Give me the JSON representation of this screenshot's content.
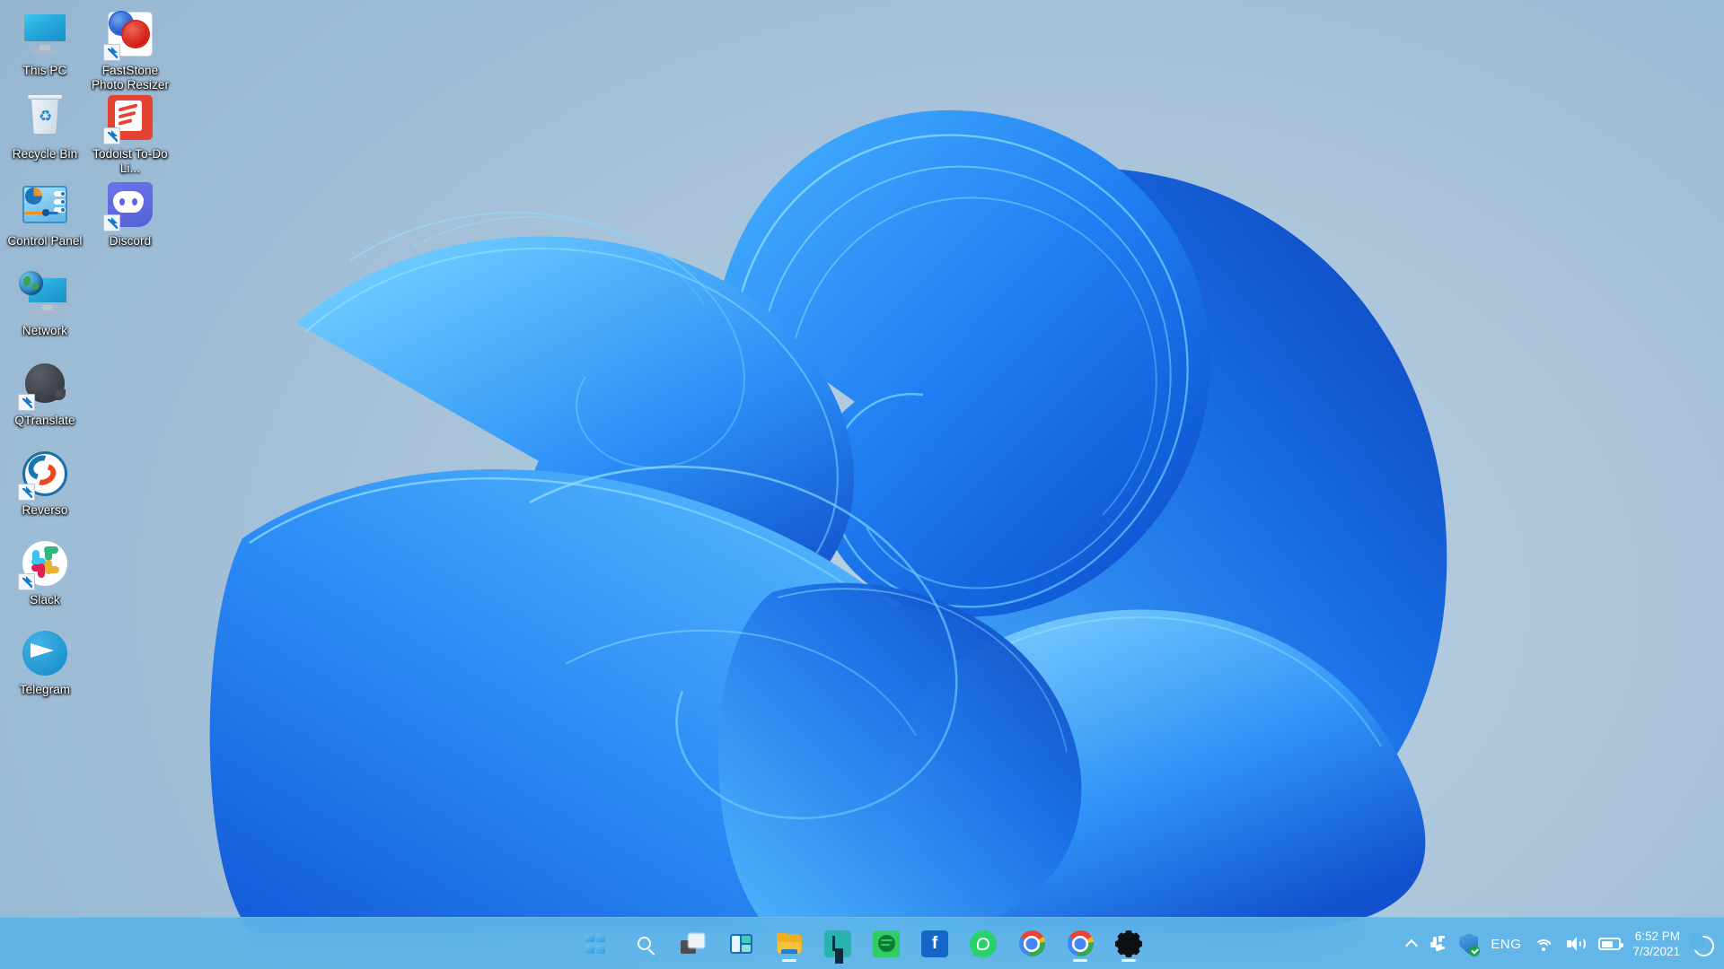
{
  "os": {
    "name": "Windows 11",
    "wallpaper": "bloom-abstract-blue"
  },
  "colors": {
    "desktop_bg": "#a9c4dc",
    "bloom_blue": "#1a7ef0",
    "bloom_light": "#43b0ff",
    "taskbar_bg": "#5ab4e9",
    "icon_label_text": "#ffffff"
  },
  "desktop": {
    "icons": [
      {
        "name": "this-pc",
        "label": "This PC",
        "shortcut": false,
        "col": 0,
        "row": 0
      },
      {
        "name": "faststone",
        "label": "FastStone Photo Resizer",
        "shortcut": true,
        "col": 1,
        "row": 0
      },
      {
        "name": "recycle-bin",
        "label": "Recycle Bin",
        "shortcut": false,
        "col": 0,
        "row": 1
      },
      {
        "name": "todoist",
        "label": "Todoist To-Do Li...",
        "shortcut": true,
        "col": 1,
        "row": 1
      },
      {
        "name": "control-panel",
        "label": "Control Panel",
        "shortcut": false,
        "col": 0,
        "row": 2
      },
      {
        "name": "discord",
        "label": "Discord",
        "shortcut": true,
        "col": 1,
        "row": 2
      },
      {
        "name": "network",
        "label": "Network",
        "shortcut": false,
        "col": 0,
        "row": 3
      },
      {
        "name": "qtranslate",
        "label": "QTranslate",
        "shortcut": true,
        "col": 0,
        "row": 4
      },
      {
        "name": "reverso",
        "label": "Reverso",
        "shortcut": true,
        "col": 0,
        "row": 5
      },
      {
        "name": "slack",
        "label": "Slack",
        "shortcut": true,
        "col": 0,
        "row": 6
      },
      {
        "name": "telegram",
        "label": "Telegram",
        "shortcut": false,
        "col": 0,
        "row": 7
      }
    ]
  },
  "taskbar": {
    "buttons": [
      {
        "name": "start",
        "label": "Start",
        "icon": "windows-logo-icon",
        "active": false
      },
      {
        "name": "search",
        "label": "Search",
        "icon": "search-icon",
        "active": false
      },
      {
        "name": "task-view",
        "label": "Task View",
        "icon": "task-view-icon",
        "active": false
      },
      {
        "name": "widgets",
        "label": "Widgets",
        "icon": "widgets-icon",
        "active": false
      },
      {
        "name": "file-explorer",
        "label": "File Explorer",
        "icon": "folder-icon",
        "active": true
      },
      {
        "name": "lightshot",
        "label": "L",
        "icon": "letter-l-icon",
        "active": false
      },
      {
        "name": "spotify",
        "label": "Spotify",
        "icon": "spotify-icon",
        "active": false
      },
      {
        "name": "facebook",
        "label": "Facebook",
        "icon": "facebook-icon",
        "active": false
      },
      {
        "name": "whatsapp",
        "label": "WhatsApp",
        "icon": "whatsapp-icon",
        "active": false
      },
      {
        "name": "chrome-1",
        "label": "Google Chrome",
        "icon": "chrome-icon",
        "active": false
      },
      {
        "name": "chrome-2",
        "label": "Google Chrome",
        "icon": "chrome-icon",
        "active": true
      },
      {
        "name": "settings",
        "label": "Settings",
        "icon": "gear-icon",
        "active": true
      }
    ],
    "tray": {
      "overflow": {
        "name": "show-hidden-icons",
        "icon": "chevron-up-icon"
      },
      "items": [
        {
          "name": "slack-tray",
          "icon": "slack-icon"
        },
        {
          "name": "windows-security",
          "icon": "shield-check-icon"
        }
      ],
      "language": "ENG",
      "network": {
        "icon": "wifi-icon",
        "label": "Network"
      },
      "volume": {
        "icon": "speaker-icon",
        "label": "Volume"
      },
      "battery": {
        "icon": "battery-icon",
        "label": "Battery",
        "level_percent": 55
      },
      "clock": {
        "time": "6:52 PM",
        "date": "7/3/2021"
      },
      "notifications": {
        "name": "notification-center",
        "icon": "moon-icon"
      }
    }
  }
}
